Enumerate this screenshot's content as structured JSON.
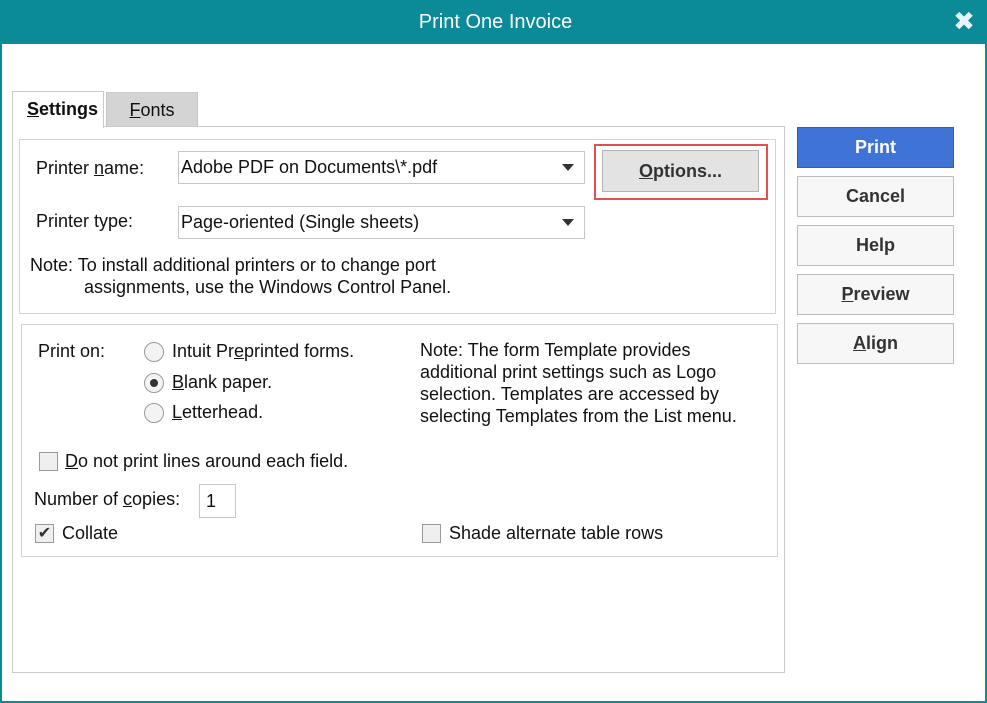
{
  "window": {
    "title": "Print One Invoice",
    "close_glyph": "✖"
  },
  "tabs": [
    {
      "label_pre": "",
      "mnemonic": "S",
      "label_post": "ettings",
      "active": true
    },
    {
      "label_pre": "",
      "mnemonic": "F",
      "label_post": "onts",
      "active": false
    }
  ],
  "printer": {
    "name_label_pre": "Printer ",
    "name_label_mnemonic": "n",
    "name_label_post": "ame:",
    "name_value": "Adobe PDF on Documents\\*.pdf",
    "type_label": "Printer type:",
    "type_value": "Page-oriented (Single sheets)",
    "options_pre": "",
    "options_mnemonic": "O",
    "options_post": "ptions...",
    "note_line1": "Note: To install additional printers or to change port",
    "note_line2": "assignments, use the Windows Control Panel."
  },
  "print_on": {
    "label": "Print on:",
    "options": [
      {
        "pre": "Intuit Pr",
        "mnemonic": "e",
        "post": "printed forms.",
        "checked": false
      },
      {
        "pre": "",
        "mnemonic": "B",
        "post": "lank paper.",
        "checked": true
      },
      {
        "pre": "",
        "mnemonic": "L",
        "post": "etterhead.",
        "checked": false
      }
    ],
    "note_lines": [
      "Note: The form Template provides",
      "additional print settings such as Logo",
      "selection.  Templates are accessed by",
      "selecting Templates from the List menu."
    ]
  },
  "options": {
    "no_lines_pre": "",
    "no_lines_mnemonic": "D",
    "no_lines_post": "o not print lines around each field.",
    "no_lines_checked": false,
    "copies_label_pre": "Number of ",
    "copies_label_mnemonic": "c",
    "copies_label_post": "opies:",
    "copies_value": "1",
    "collate_label": "Collate",
    "collate_checked": true,
    "shade_label": "Shade alternate table rows",
    "shade_checked": false
  },
  "buttons": {
    "print": "Print",
    "cancel": "Cancel",
    "help": "Help",
    "preview_mnemonic": "P",
    "preview_post": "review",
    "align_mnemonic": "A",
    "align_post": "lign"
  },
  "colors": {
    "titlebar": "#0b8a98",
    "primary_button": "#3f73d6",
    "highlight": "#e05050"
  }
}
